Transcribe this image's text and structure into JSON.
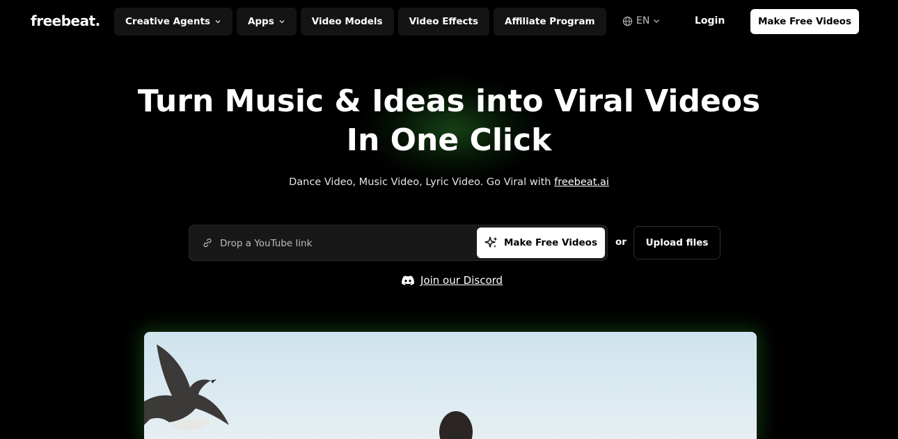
{
  "header": {
    "logo": "freebeat.",
    "nav": [
      {
        "label": "Creative Agents",
        "has_dropdown": true
      },
      {
        "label": "Apps",
        "has_dropdown": true
      },
      {
        "label": "Video Models",
        "has_dropdown": false
      },
      {
        "label": "Video Effects",
        "has_dropdown": false
      },
      {
        "label": "Affiliate Program",
        "has_dropdown": false
      }
    ],
    "language": "EN",
    "login": "Login",
    "cta": "Make Free Videos"
  },
  "hero": {
    "title_line1": "Turn Music & Ideas into Viral Videos",
    "title_line2": "In One Click",
    "subtitle_prefix": "Dance Video, Music Video, Lyric Video. Go Viral with ",
    "subtitle_link": "freebeat.ai",
    "input_placeholder": "Drop a YouTube link",
    "make_button": "Make Free Videos",
    "or_text": "or",
    "upload_button": "Upload files",
    "discord_link": "Join our Discord"
  },
  "icons": {
    "globe": "globe-icon",
    "chevron": "chevron-down-icon",
    "link": "link-icon",
    "sparkle": "sparkle-icon",
    "discord": "discord-icon"
  },
  "colors": {
    "background": "#000000",
    "nav_item_bg": "#141414",
    "glow": "#2a7a2a"
  }
}
